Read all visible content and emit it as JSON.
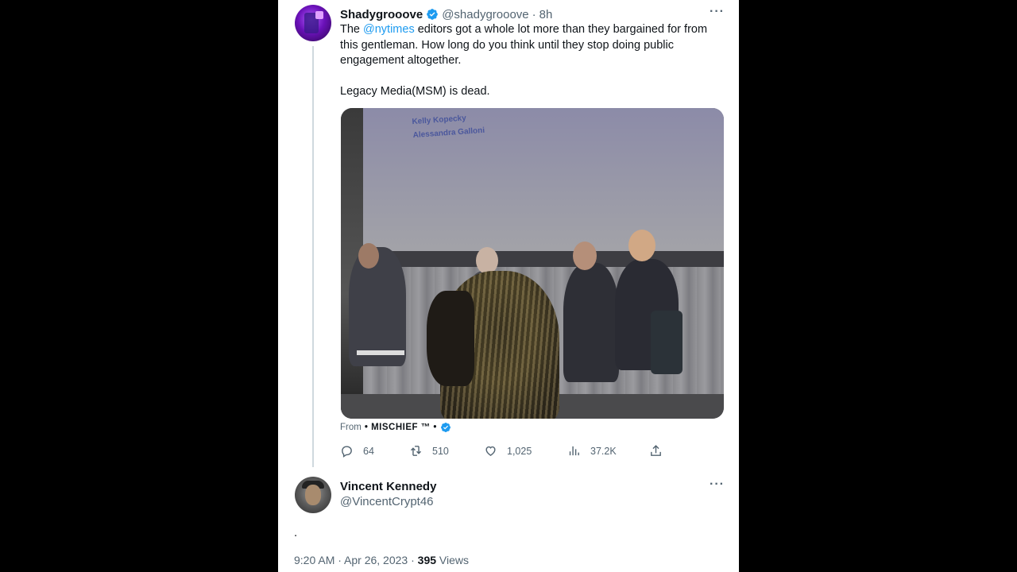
{
  "colors": {
    "accent": "#1d9bf0",
    "secondary_text": "#536471",
    "primary_text": "#0f1419"
  },
  "tweet": {
    "author_name": "Shadygrooove",
    "author_handle": "@shadygrooove",
    "separator": "·",
    "time_ago": "8h",
    "text_before_mention": "The ",
    "mention": "@nytimes",
    "text_after_mention": " editors got a whole lot more than they bargained for from this gentleman. How long do you think until they stop doing public engagement altogether.",
    "text_second_paragraph": "Legacy Media(MSM) is dead.",
    "more_icon": "more-icon",
    "media": {
      "screen_line1": "Kelly Kopecky",
      "screen_line2": "Alessandra Galloni"
    },
    "from_label": "From",
    "from_source": "• MISCHIEF ™ •",
    "stats": {
      "replies": "64",
      "retweets": "510",
      "likes": "1,025",
      "views": "37.2K"
    }
  },
  "reply": {
    "author_name": "Vincent Kennedy",
    "author_handle": "@VincentCrypt46",
    "body": ".",
    "timestamp": "9:20 AM · Apr 26, 2023 · ",
    "views_count": "395",
    "views_label": " Views"
  }
}
